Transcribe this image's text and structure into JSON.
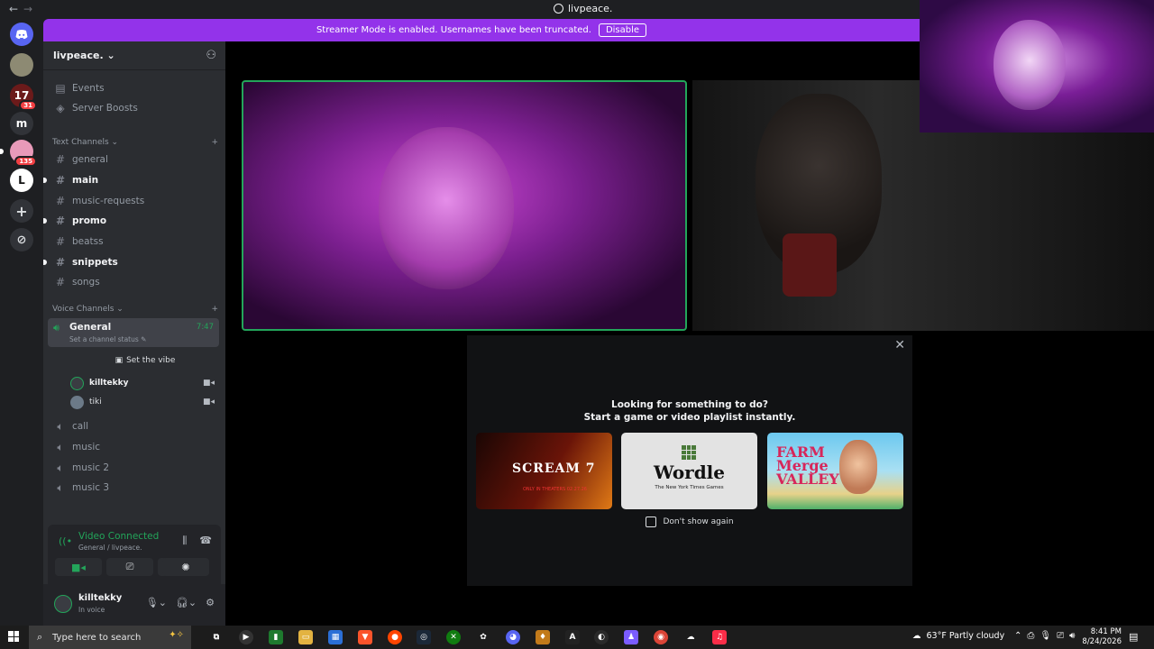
{
  "window": {
    "title": "livpeace.",
    "back": "←",
    "forward": "→"
  },
  "banner": {
    "text": "Streamer Mode is enabled. Usernames have been truncated.",
    "button": "Disable"
  },
  "rail": {
    "servers": [
      {
        "label": "",
        "badge": ""
      },
      {
        "label": "17",
        "badge": "31"
      },
      {
        "label": "m",
        "badge": ""
      },
      {
        "label": "",
        "badge": "135"
      },
      {
        "label": "L",
        "badge": ""
      }
    ]
  },
  "guild": {
    "name": "livpeace. ⌄"
  },
  "nav": {
    "events": "Events",
    "boosts": "Server Boosts"
  },
  "text_channels": {
    "header": "Text Channels ⌄",
    "items": [
      {
        "name": "general",
        "unread": false
      },
      {
        "name": "main",
        "unread": true
      },
      {
        "name": "music-requests",
        "unread": false
      },
      {
        "name": "promo",
        "unread": true
      },
      {
        "name": "beatss",
        "unread": false
      },
      {
        "name": "snippets",
        "unread": true
      },
      {
        "name": "songs",
        "unread": false
      }
    ]
  },
  "voice_channels": {
    "header": "Voice Channels ⌄",
    "active": {
      "name": "General",
      "status": "Set a channel status ✎",
      "time": "7:47"
    },
    "vibe": "Set the vibe",
    "members": [
      {
        "name": "killtekky"
      },
      {
        "name": "tiki"
      }
    ],
    "others": [
      "call",
      "music",
      "music 2",
      "music 3"
    ]
  },
  "voice_panel": {
    "status": "Video Connected",
    "sub": "General / livpeace."
  },
  "user": {
    "name": "killtekky",
    "status": "In voice"
  },
  "activity": {
    "line1": "Looking for something to do?",
    "line2": "Start a game or video playlist instantly.",
    "close": "✕",
    "cards": [
      {
        "title": "SCREAM 7",
        "subtitle": "ONLY IN THEATERS 02.27.26"
      },
      {
        "title": "Wordle",
        "subtitle": "The New York Times Games"
      },
      {
        "title": "FARM Merge VALLEY"
      }
    ],
    "checkbox": "Don't show again"
  },
  "taskbar": {
    "search": "Type here to search",
    "weather": "63°F  Partly cloudy",
    "time": "8:41 PM",
    "date": "8/24/2026"
  },
  "colors": {
    "accent": "#9333ea",
    "green": "#23a55a",
    "sidebar": "#2b2d31"
  }
}
